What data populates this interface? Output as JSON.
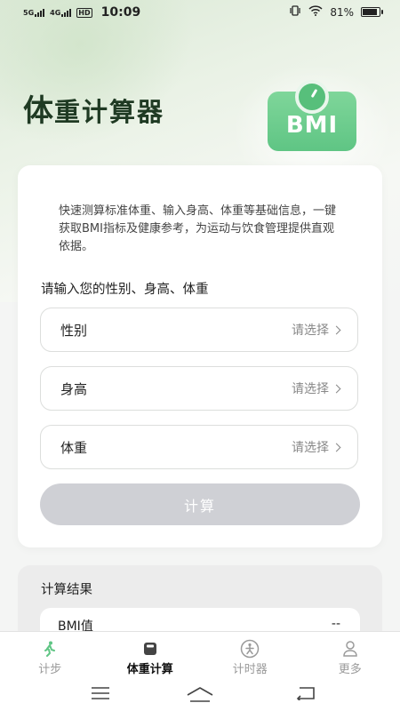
{
  "status_bar": {
    "sim1": "5G",
    "sim2": "4G",
    "hd": "HD",
    "time": "10:09",
    "battery": "81%"
  },
  "header": {
    "title_big": "体",
    "title_rest": "重计算器",
    "badge_text": "BMI"
  },
  "card": {
    "intro": "快速测算标准体重、输入身高、体重等基础信息，一键获取BMI指标及健康参考，为运动与饮食管理提供直观依据。",
    "prompt": "请输入您的性别、身高、体重",
    "fields": [
      {
        "label": "性别",
        "placeholder": "请选择"
      },
      {
        "label": "身高",
        "placeholder": "请选择"
      },
      {
        "label": "体重",
        "placeholder": "请选择"
      }
    ],
    "button": "计算"
  },
  "result": {
    "title": "计算结果",
    "row_label": "BMI值",
    "row_value": "--"
  },
  "tabs": [
    {
      "label": "计步",
      "icon": "walking-icon"
    },
    {
      "label": "体重计算",
      "icon": "scale-icon"
    },
    {
      "label": "计时器",
      "icon": "timer-icon"
    },
    {
      "label": "更多",
      "icon": "user-icon"
    }
  ],
  "colors": {
    "accent_green": "#5fc584",
    "title_green": "#1f3a23",
    "button_disabled": "#cfd0d5"
  }
}
